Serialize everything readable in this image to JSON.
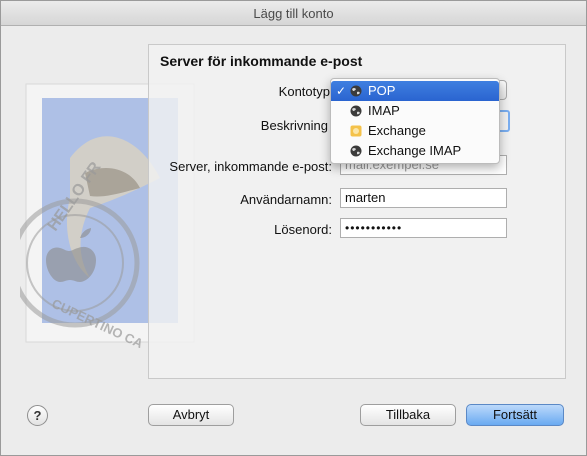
{
  "window": {
    "title": "Lägg till konto"
  },
  "section": {
    "title": "Server för inkommande e-post"
  },
  "form": {
    "account_type_label": "Kontotyp",
    "description_label": "Beskrivning",
    "incoming_server_label": "Server, inkommande e-post:",
    "incoming_server_placeholder": "mail.exempel.se",
    "username_label": "Användarnamn:",
    "username_value": "marten",
    "password_label": "Lösenord:",
    "password_value": "•••••••••••"
  },
  "account_type_menu": {
    "selected": "POP",
    "items": [
      {
        "label": "POP",
        "icon": "globe-icon",
        "checked": true
      },
      {
        "label": "IMAP",
        "icon": "globe-icon",
        "checked": false
      },
      {
        "label": "Exchange",
        "icon": "exchange-icon",
        "checked": false
      },
      {
        "label": "Exchange IMAP",
        "icon": "globe-icon",
        "checked": false
      }
    ],
    "check_mark": "✓"
  },
  "buttons": {
    "help": "?",
    "cancel": "Avbryt",
    "back": "Tillbaka",
    "continue": "Fortsätt"
  },
  "stamp_text": {
    "top": "HELLO FR",
    "bottom": "CUPERTINO CA"
  },
  "colors": {
    "selection": "#2a64d0",
    "default_button": "#6aaaf1",
    "focus_ring": "#7aaef0"
  }
}
